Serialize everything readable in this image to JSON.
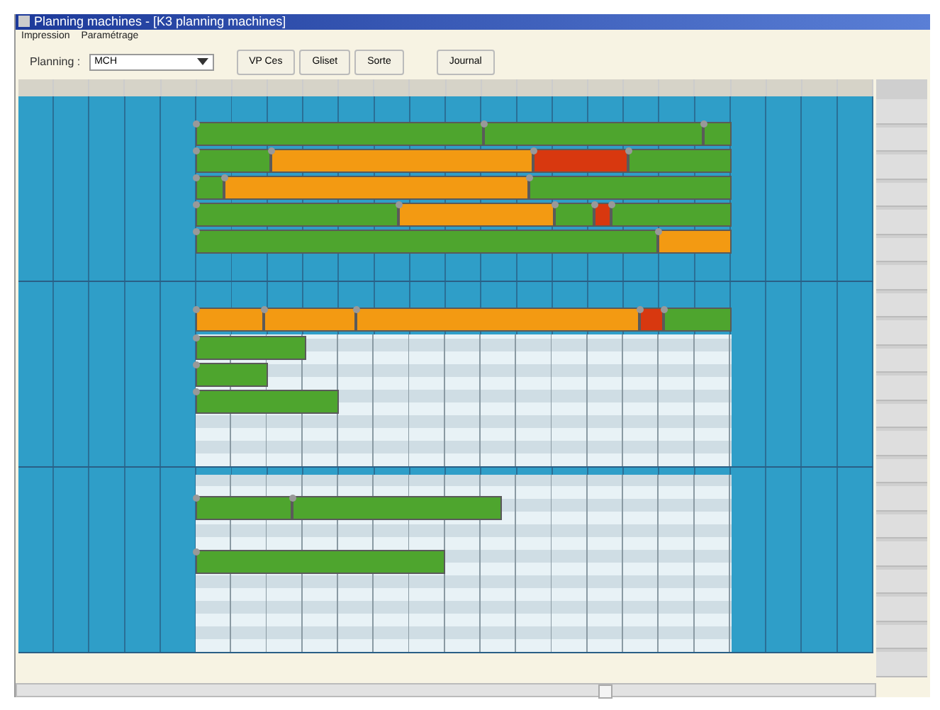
{
  "window": {
    "title": "Planning machines - [K3 planning machines]"
  },
  "menu": [
    "Impression",
    "Paramétrage"
  ],
  "toolbar": {
    "planning_label": "Planning :",
    "planning_value": "MCH",
    "buttons": [
      "VP Ces",
      "Gliset",
      "Sorte",
      "Journal"
    ]
  },
  "groups": [
    {
      "rows": [
        {
          "bars": [
            {
              "kind": "running"
            },
            {
              "kind": "running"
            },
            {
              "kind": "running"
            }
          ]
        },
        {
          "bars": [
            {
              "kind": "running"
            },
            {
              "kind": "waiting"
            },
            {
              "kind": "late"
            },
            {
              "kind": "running"
            }
          ]
        },
        {
          "bars": [
            {
              "kind": "running"
            },
            {
              "kind": "waiting"
            },
            {
              "kind": "running"
            }
          ]
        },
        {
          "bars": [
            {
              "kind": "running"
            },
            {
              "kind": "waiting"
            },
            {
              "kind": "running"
            },
            {
              "kind": "late"
            },
            {
              "kind": "running"
            }
          ]
        },
        {
          "bars": [
            {
              "kind": "running"
            },
            {
              "kind": "waiting"
            }
          ]
        }
      ]
    },
    {
      "rows": [
        {
          "bars": [
            {
              "kind": "waiting"
            },
            {
              "kind": "waiting"
            },
            {
              "kind": "waiting"
            },
            {
              "kind": "late"
            },
            {
              "kind": "running"
            }
          ]
        },
        {
          "bars": [
            {
              "kind": "running"
            }
          ]
        },
        {
          "bars": [
            {
              "kind": "running"
            }
          ]
        },
        {
          "bars": [
            {
              "kind": "running"
            }
          ]
        }
      ]
    },
    {
      "rows": [
        {
          "bars": [
            {
              "kind": "running"
            },
            {
              "kind": "running"
            }
          ]
        },
        {
          "bars": [
            {
              "kind": "running"
            }
          ]
        }
      ]
    }
  ]
}
